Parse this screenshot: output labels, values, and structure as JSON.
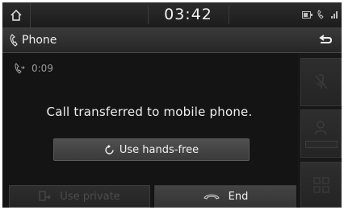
{
  "status_bar": {
    "time": "03:42",
    "home_icon": "home-icon",
    "icons": [
      "battery-icon",
      "phone-signal-icon",
      "signal-strength-icon"
    ]
  },
  "title_bar": {
    "title": "Phone",
    "icon": "phone-icon",
    "back_icon": "back-arrow-icon"
  },
  "call": {
    "duration": "0:09",
    "message": "Call transferred to mobile phone."
  },
  "buttons": {
    "hands_free": "Use hands-free",
    "private": "Use private",
    "end": "End"
  },
  "side_panel": {
    "items": [
      "mute-microphone-icon",
      "contact-transfer-icon",
      "keypad-icon"
    ]
  },
  "colors": {
    "background": "#141414",
    "text": "#f0f0f0",
    "disabled_text": "#4c4c4c",
    "button": "#444444"
  }
}
